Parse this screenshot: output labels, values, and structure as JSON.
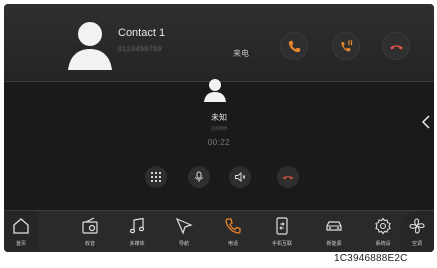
{
  "incoming_call": {
    "contact_name": "Contact 1",
    "number": "0123456789",
    "status": "来电"
  },
  "active_call": {
    "caller_name": "未知",
    "number": "10086",
    "duration": "00:22"
  },
  "dock": {
    "items": [
      {
        "label": "首页",
        "icon": "home-icon"
      },
      {
        "label": "收音",
        "icon": "radio-icon"
      },
      {
        "label": "多媒体",
        "icon": "music-icon"
      },
      {
        "label": "导航",
        "icon": "navigation-icon"
      },
      {
        "label": "电话",
        "icon": "phone-icon"
      },
      {
        "label": "手机互联",
        "icon": "phone-link-icon"
      },
      {
        "label": "新能源",
        "icon": "car-icon"
      },
      {
        "label": "系统设",
        "icon": "gear-icon"
      },
      {
        "label": "空调",
        "icon": "fan-icon"
      }
    ]
  },
  "image_code": "1C3946888E2C",
  "colors": {
    "accent_orange": "#e8842c",
    "background": "#1c1c1c",
    "hangup_red": "#e0524a"
  }
}
